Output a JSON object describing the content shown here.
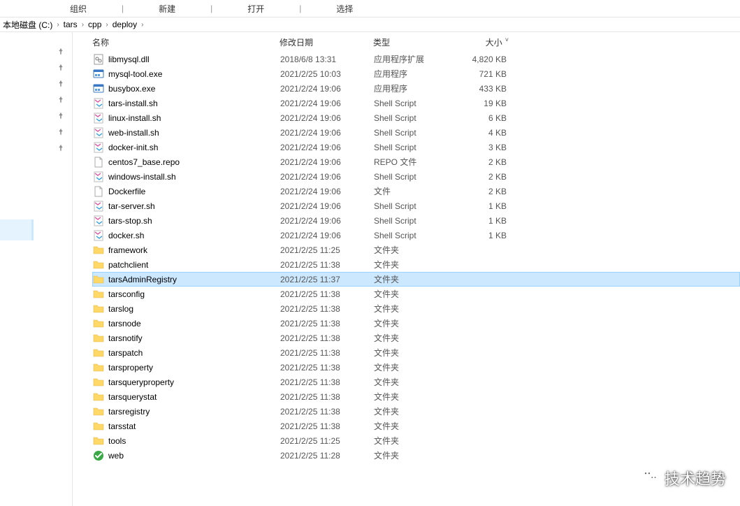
{
  "toolbar": {
    "organize": "组织",
    "new": "新建",
    "open": "打开",
    "select": "选择"
  },
  "breadcrumb": {
    "root": "本地磁盘 (C:)",
    "p1": "tars",
    "p2": "cpp",
    "p3": "deploy"
  },
  "columns": {
    "name": "名称",
    "date": "修改日期",
    "type": "类型",
    "size": "大小"
  },
  "files": [
    {
      "icon": "dll",
      "name": "libmysql.dll",
      "date": "2018/6/8 13:31",
      "type": "应用程序扩展",
      "size": "4,820 KB"
    },
    {
      "icon": "exe",
      "name": "mysql-tool.exe",
      "date": "2021/2/25 10:03",
      "type": "应用程序",
      "size": "721 KB"
    },
    {
      "icon": "exe",
      "name": "busybox.exe",
      "date": "2021/2/24 19:06",
      "type": "应用程序",
      "size": "433 KB"
    },
    {
      "icon": "sh",
      "name": "tars-install.sh",
      "date": "2021/2/24 19:06",
      "type": "Shell Script",
      "size": "19 KB"
    },
    {
      "icon": "sh",
      "name": "linux-install.sh",
      "date": "2021/2/24 19:06",
      "type": "Shell Script",
      "size": "6 KB"
    },
    {
      "icon": "sh",
      "name": "web-install.sh",
      "date": "2021/2/24 19:06",
      "type": "Shell Script",
      "size": "4 KB"
    },
    {
      "icon": "sh",
      "name": "docker-init.sh",
      "date": "2021/2/24 19:06",
      "type": "Shell Script",
      "size": "3 KB"
    },
    {
      "icon": "file",
      "name": "centos7_base.repo",
      "date": "2021/2/24 19:06",
      "type": "REPO 文件",
      "size": "2 KB"
    },
    {
      "icon": "sh",
      "name": "windows-install.sh",
      "date": "2021/2/24 19:06",
      "type": "Shell Script",
      "size": "2 KB"
    },
    {
      "icon": "file",
      "name": "Dockerfile",
      "date": "2021/2/24 19:06",
      "type": "文件",
      "size": "2 KB"
    },
    {
      "icon": "sh",
      "name": "tar-server.sh",
      "date": "2021/2/24 19:06",
      "type": "Shell Script",
      "size": "1 KB"
    },
    {
      "icon": "sh",
      "name": "tars-stop.sh",
      "date": "2021/2/24 19:06",
      "type": "Shell Script",
      "size": "1 KB"
    },
    {
      "icon": "sh",
      "name": "docker.sh",
      "date": "2021/2/24 19:06",
      "type": "Shell Script",
      "size": "1 KB"
    },
    {
      "icon": "folder",
      "name": "framework",
      "date": "2021/2/25 11:25",
      "type": "文件夹",
      "size": ""
    },
    {
      "icon": "folder",
      "name": "patchclient",
      "date": "2021/2/25 11:38",
      "type": "文件夹",
      "size": ""
    },
    {
      "icon": "folder",
      "name": "tarsAdminRegistry",
      "date": "2021/2/25 11:37",
      "type": "文件夹",
      "size": "",
      "selected": true
    },
    {
      "icon": "folder",
      "name": "tarsconfig",
      "date": "2021/2/25 11:38",
      "type": "文件夹",
      "size": ""
    },
    {
      "icon": "folder",
      "name": "tarslog",
      "date": "2021/2/25 11:38",
      "type": "文件夹",
      "size": ""
    },
    {
      "icon": "folder",
      "name": "tarsnode",
      "date": "2021/2/25 11:38",
      "type": "文件夹",
      "size": ""
    },
    {
      "icon": "folder",
      "name": "tarsnotify",
      "date": "2021/2/25 11:38",
      "type": "文件夹",
      "size": ""
    },
    {
      "icon": "folder",
      "name": "tarspatch",
      "date": "2021/2/25 11:38",
      "type": "文件夹",
      "size": ""
    },
    {
      "icon": "folder",
      "name": "tarsproperty",
      "date": "2021/2/25 11:38",
      "type": "文件夹",
      "size": ""
    },
    {
      "icon": "folder",
      "name": "tarsqueryproperty",
      "date": "2021/2/25 11:38",
      "type": "文件夹",
      "size": ""
    },
    {
      "icon": "folder",
      "name": "tarsquerystat",
      "date": "2021/2/25 11:38",
      "type": "文件夹",
      "size": ""
    },
    {
      "icon": "folder",
      "name": "tarsregistry",
      "date": "2021/2/25 11:38",
      "type": "文件夹",
      "size": ""
    },
    {
      "icon": "folder",
      "name": "tarsstat",
      "date": "2021/2/25 11:38",
      "type": "文件夹",
      "size": ""
    },
    {
      "icon": "folder",
      "name": "tools",
      "date": "2021/2/25 11:25",
      "type": "文件夹",
      "size": ""
    },
    {
      "icon": "web",
      "name": "web",
      "date": "2021/2/25 11:28",
      "type": "文件夹",
      "size": ""
    }
  ],
  "watermark": {
    "text": "技术趋势"
  }
}
